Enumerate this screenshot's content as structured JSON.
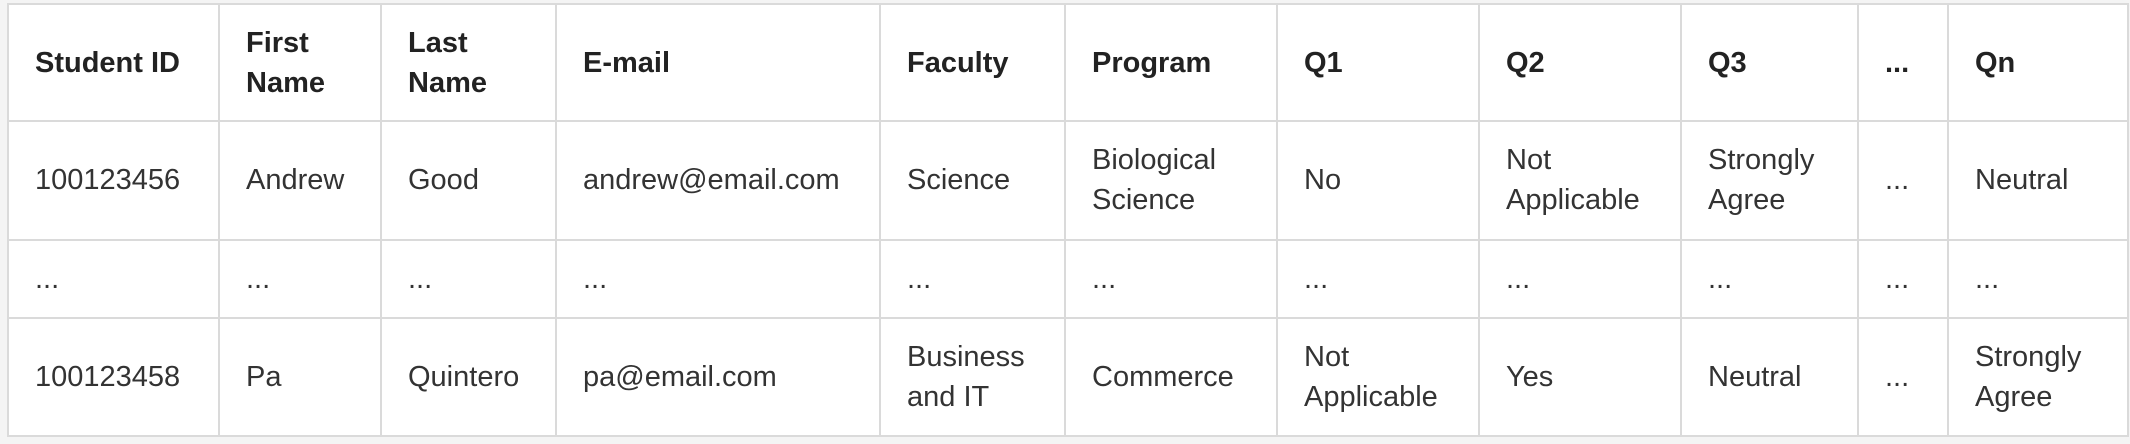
{
  "table": {
    "headers": [
      "Student ID",
      "First Name",
      "Last Name",
      "E-mail",
      "Faculty",
      "Program",
      "Q1",
      "Q2",
      "Q3",
      "...",
      "Qn"
    ],
    "rows": [
      [
        "100123456",
        "Andrew",
        "Good",
        "andrew@email.com",
        "Science",
        "Biological Science",
        "No",
        "Not Applicable",
        "Strongly Agree",
        "...",
        "Neutral"
      ],
      [
        "...",
        "...",
        "...",
        "...",
        "...",
        "...",
        "...",
        "...",
        "...",
        "...",
        "..."
      ],
      [
        "100123458",
        "Pa",
        "Quintero",
        "pa@email.com",
        "Business and IT",
        "Commerce",
        "Not Applicable",
        "Yes",
        "Neutral",
        "...",
        "Strongly Agree"
      ]
    ]
  }
}
